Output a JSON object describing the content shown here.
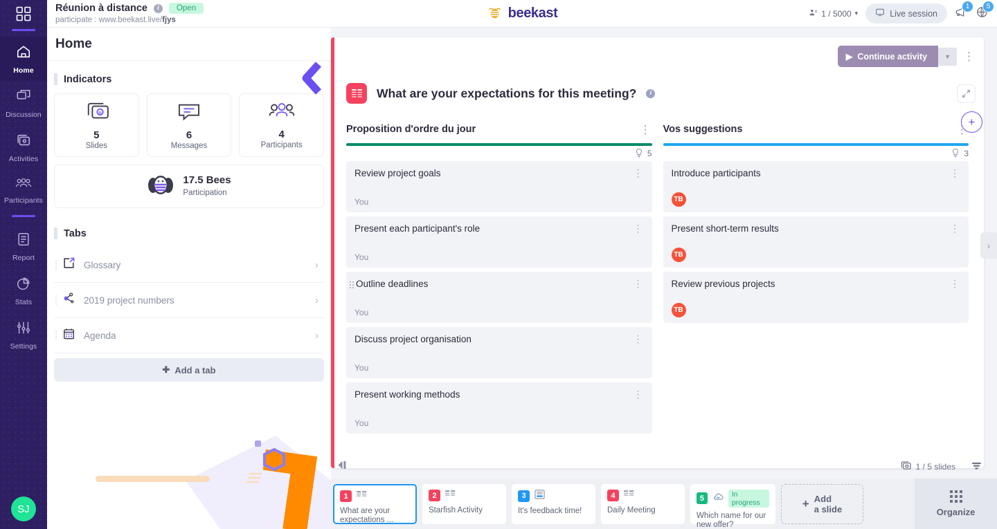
{
  "rail": {
    "logo_icon": "grid-logo-icon",
    "items": [
      {
        "label": "Home",
        "icon": "home-icon",
        "active": true
      },
      {
        "label": "Discussion",
        "icon": "chat-icon",
        "active": false
      },
      {
        "label": "Activities",
        "icon": "slides-icon",
        "active": false
      },
      {
        "label": "Participants",
        "icon": "people-icon",
        "active": false
      },
      {
        "label": "Report",
        "icon": "report-icon",
        "active": false
      },
      {
        "label": "Stats",
        "icon": "pie-chart-icon",
        "active": false
      },
      {
        "label": "Settings",
        "icon": "sliders-icon",
        "active": false
      }
    ],
    "avatar_initials": "SJ",
    "avatar_color": "#1fe396"
  },
  "topbar": {
    "meeting_title": "Réunion à distance",
    "info_icon": "info-icon",
    "status_badge": "Open",
    "participate_label": "participate :",
    "participate_url": "www.beekast.live/",
    "participate_code": "fjys",
    "brand_name": "beekast",
    "brand_icon": "bee-logo-icon",
    "capacity": "1 / 5000",
    "capacity_icon": "participants-icon",
    "capacity_caret": "chevron-down-icon",
    "live_session": "Live session",
    "live_icon": "screen-icon",
    "megaphone_icon": "megaphone-icon",
    "megaphone_badge": "1",
    "globe_icon": "globe-icon",
    "globe_badge": "5",
    "badge_color": "#4aa8f0"
  },
  "home": {
    "page_title": "Home",
    "indicators_title": "Indicators",
    "indicators": [
      {
        "value": "5",
        "label": "Slides",
        "icon": "slides-icon"
      },
      {
        "value": "6",
        "label": "Messages",
        "icon": "message-icon"
      },
      {
        "value": "4",
        "label": "Participants",
        "icon": "people-icon"
      }
    ],
    "bees": {
      "value": "17.5 Bees",
      "label": "Participation",
      "icon": "bee-avatar-icon"
    },
    "tabs_title": "Tabs",
    "tabs": [
      {
        "label": "Glossary",
        "icon": "external-link-icon"
      },
      {
        "label": "2019 project numbers",
        "icon": "graph-node-icon"
      },
      {
        "label": "Agenda",
        "icon": "calendar-icon"
      }
    ],
    "add_tab": "Add a tab"
  },
  "activity": {
    "accent_color": "#f4435f",
    "continue_label": "Continue activity",
    "play_icon": "play-icon",
    "caret_icon": "caret-down-icon",
    "kebab_icon": "kebab-menu-icon",
    "title": "What are your expectations for this meeting?",
    "title_icon": "board-activity-icon",
    "info_icon": "info-icon",
    "expand_icon": "expand-icon",
    "add_idea_icon": "plus-icon",
    "side_arrow_icon": "chevron-right-icon",
    "columns": [
      {
        "name": "Proposition d'ordre du jour",
        "bar_color": "#0b8a6a",
        "idea_icon": "lightbulb-icon",
        "count": "5",
        "notes": [
          {
            "text": "Review project goals",
            "author": "You",
            "author_type": "text",
            "dragging": false
          },
          {
            "text": "Present each participant's role",
            "author": "You",
            "author_type": "text",
            "dragging": false
          },
          {
            "text": "Outline deadlines",
            "author": "You",
            "author_type": "text",
            "dragging": true
          },
          {
            "text": "Discuss project organisation",
            "author": "You",
            "author_type": "text",
            "dragging": false
          },
          {
            "text": "Present working methods",
            "author": "You",
            "author_type": "text",
            "dragging": false
          }
        ]
      },
      {
        "name": "Vos suggestions",
        "bar_color": "#22a6ef",
        "idea_icon": "lightbulb-icon",
        "count": "3",
        "notes": [
          {
            "text": "Introduce participants",
            "author": "TB",
            "author_type": "avatar",
            "dragging": false
          },
          {
            "text": "Present short-term results",
            "author": "TB",
            "author_type": "avatar",
            "dragging": false
          },
          {
            "text": "Review previous projects",
            "author": "TB",
            "author_type": "avatar",
            "dragging": false
          }
        ]
      }
    ]
  },
  "footer": {
    "collapse_icon": "collapse-panel-icon",
    "slides_count": "1 / 5 slides",
    "slides_icon": "slides-stack-icon",
    "filter_icon": "filter-icon",
    "slides": [
      {
        "num": "1",
        "num_color": "#f4435f",
        "icon": "board-activity-icon",
        "title": "What are your expectations ...",
        "selected": true,
        "status": ""
      },
      {
        "num": "2",
        "num_color": "#f4435f",
        "icon": "board-activity-icon",
        "title": "Starfish Activity",
        "selected": false,
        "status": ""
      },
      {
        "num": "3",
        "num_color": "#2196f3",
        "icon": "form-activity-icon",
        "title": "It's feedback time!",
        "selected": false,
        "status": ""
      },
      {
        "num": "4",
        "num_color": "#f4435f",
        "icon": "board-activity-icon",
        "title": "Daily Meeting",
        "selected": false,
        "status": ""
      },
      {
        "num": "5",
        "num_color": "#16b97e",
        "icon": "cloud-activity-icon",
        "title": "Which name for our new offer?",
        "selected": false,
        "status": "In progress"
      }
    ],
    "add_slide_line1": "Add",
    "add_slide_line2": "a slide",
    "add_slide_icon": "plus-icon",
    "organize_label": "Organize",
    "organize_icon": "grid-dots-icon"
  }
}
